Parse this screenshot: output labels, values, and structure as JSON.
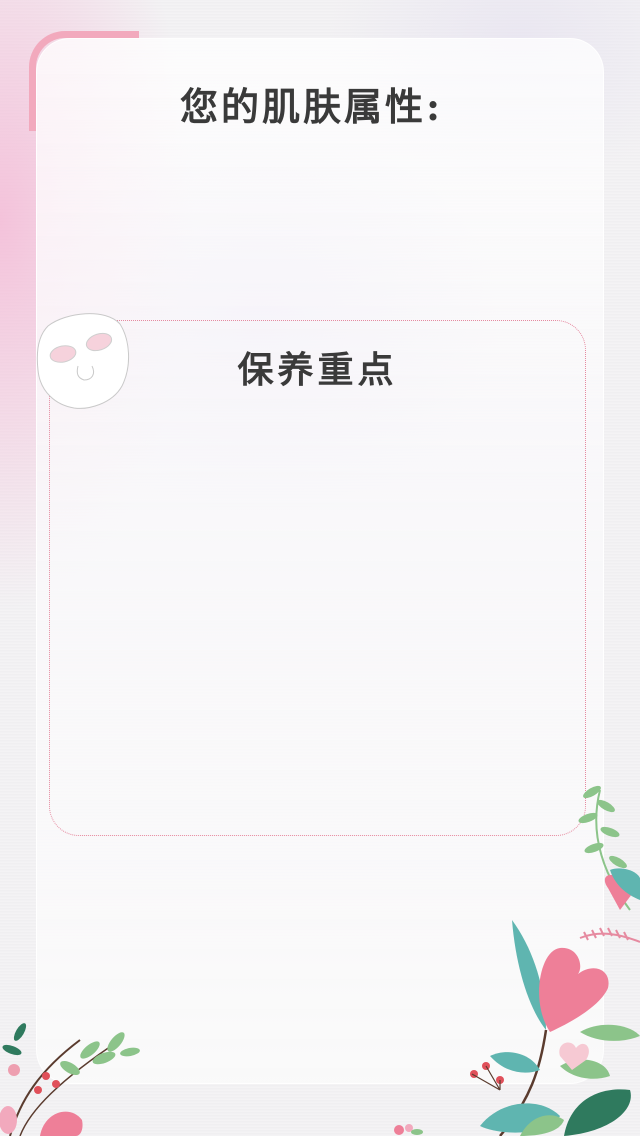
{
  "page": {
    "title": "您的肌肤属性:"
  },
  "focus_section": {
    "title": "保养重点"
  },
  "colors": {
    "accent_pink": "#f2a9bd",
    "border_pink": "#e68aa0",
    "leaf_teal": "#5fb5b0",
    "leaf_green": "#8cc48a",
    "flower_pink": "#ee7f98",
    "text_dark": "#3a3a3a"
  },
  "icons": {
    "mask": "face-mask-icon",
    "floral_left": "floral-decoration",
    "floral_right": "floral-decoration"
  }
}
